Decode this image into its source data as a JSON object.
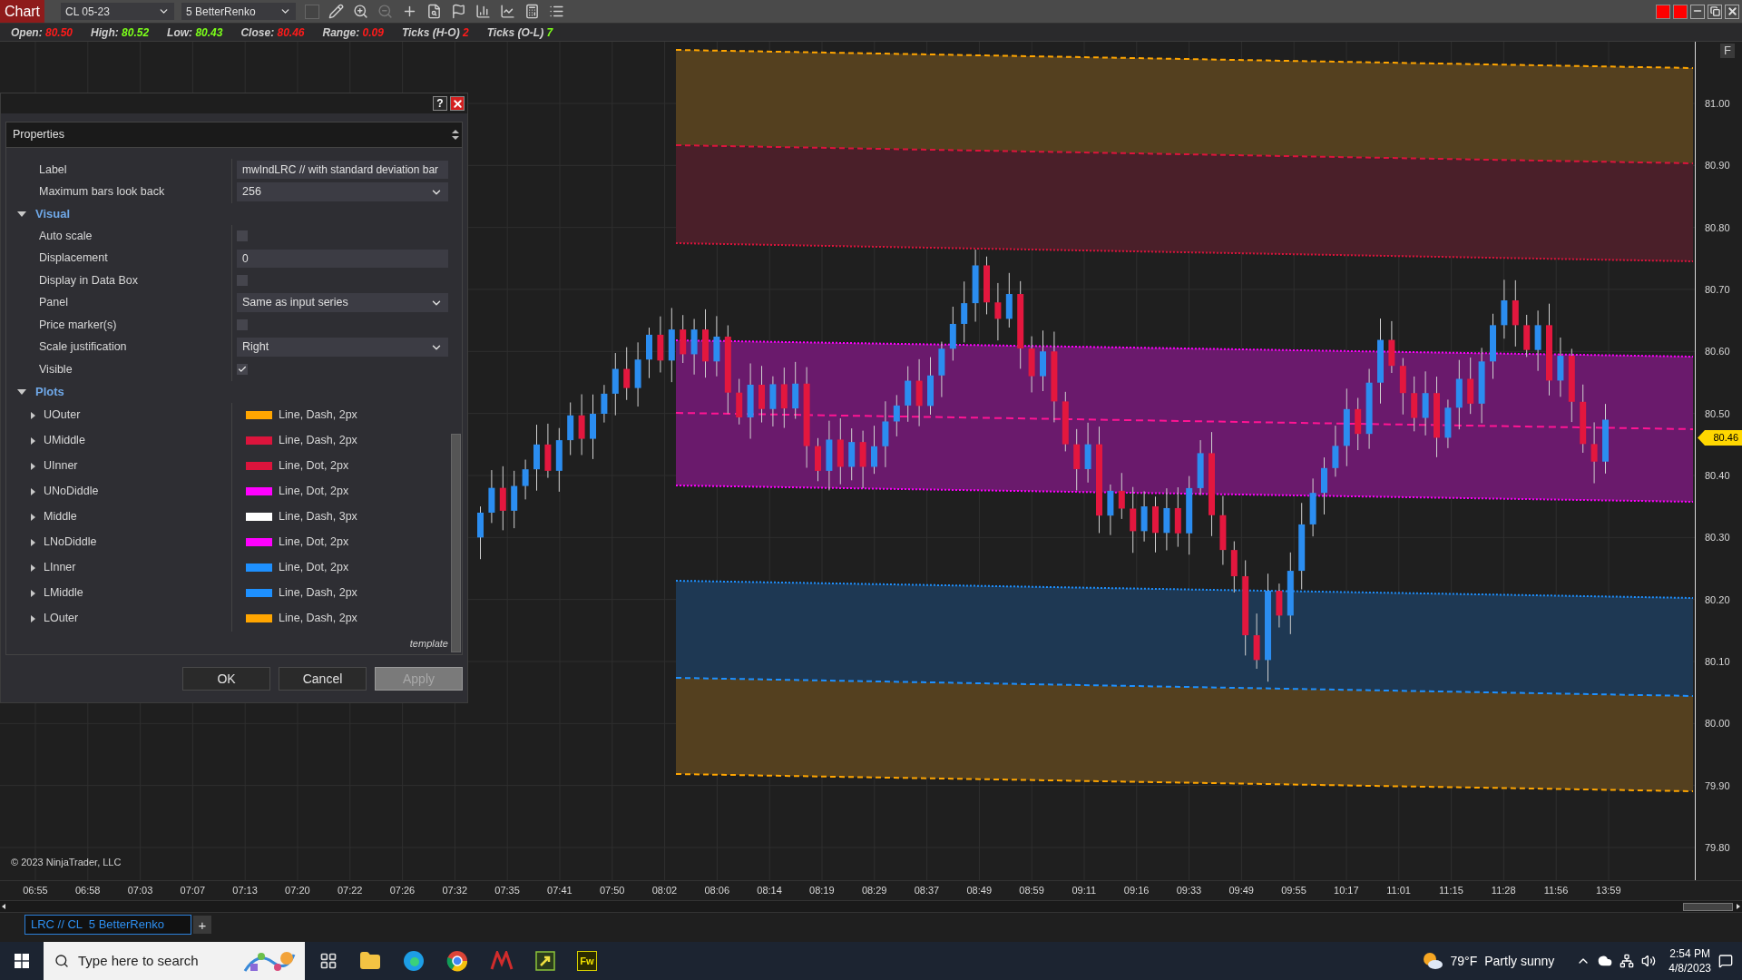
{
  "toolbar": {
    "title": "Chart",
    "instrument": "CL 05-23",
    "bar_type": "5 BetterRenko"
  },
  "data_line": [
    {
      "label": "Open:",
      "value": "80.50",
      "color": "#ff1a1a"
    },
    {
      "label": "High:",
      "value": "80.52",
      "color": "#7cff1a"
    },
    {
      "label": "Low:",
      "value": "80.43",
      "color": "#7cff1a"
    },
    {
      "label": "Close:",
      "value": "80.46",
      "color": "#ff1a1a"
    },
    {
      "label": "Range:",
      "value": "0.09",
      "color": "#ff1a1a"
    },
    {
      "label": "Ticks (H-O)",
      "value": "2",
      "color": "#ff1a1a"
    },
    {
      "label": "Ticks (O-L)",
      "value": "7",
      "color": "#7cff1a"
    }
  ],
  "dialog": {
    "help": "?",
    "header": "Properties",
    "properties": [
      {
        "kind": "text",
        "label": "Label",
        "value": "mwIndLRC // with standard deviation bar"
      },
      {
        "kind": "dropdown",
        "label": "Maximum bars look back",
        "value": "256"
      },
      {
        "kind": "section",
        "label": "Visual",
        "expanded": true
      },
      {
        "kind": "checkbox",
        "label": "Auto scale",
        "checked": false
      },
      {
        "kind": "text",
        "label": "Displacement",
        "value": "0"
      },
      {
        "kind": "checkbox",
        "label": "Display in Data Box",
        "checked": false
      },
      {
        "kind": "dropdown",
        "label": "Panel",
        "value": "Same as input series"
      },
      {
        "kind": "checkbox",
        "label": "Price marker(s)",
        "checked": false
      },
      {
        "kind": "dropdown",
        "label": "Scale justification",
        "value": "Right"
      },
      {
        "kind": "checkbox",
        "label": "Visible",
        "checked": true
      },
      {
        "kind": "section",
        "label": "Plots",
        "expanded": true
      }
    ],
    "plots": [
      {
        "name": "UOuter",
        "color": "#ffa500",
        "style": "Line, Dash, 2px",
        "expanded": false
      },
      {
        "name": "UMiddle",
        "color": "#dc143c",
        "style": "Line, Dash, 2px",
        "expanded": false
      },
      {
        "name": "UInner",
        "color": "#dc143c",
        "style": "Line, Dot, 2px",
        "expanded": false
      },
      {
        "name": "UNoDiddle",
        "color": "#ff00ff",
        "style": "Line, Dot, 2px",
        "expanded": false
      },
      {
        "name": "Middle",
        "color": "#ffffff",
        "style": "Line, Dash, 3px",
        "expanded": false
      },
      {
        "name": "LNoDiddle",
        "color": "#ff00ff",
        "style": "Line, Dot, 2px",
        "expanded": false
      },
      {
        "name": "LInner",
        "color": "#1e90ff",
        "style": "Line, Dot, 2px",
        "expanded": false
      },
      {
        "name": "LMiddle",
        "color": "#1e90ff",
        "style": "Line, Dash, 2px",
        "expanded": false
      },
      {
        "name": "LOuter",
        "color": "#ffa500",
        "style": "Line, Dash, 2px",
        "expanded": false
      }
    ],
    "template_link": "template",
    "buttons": [
      {
        "label": "OK",
        "disabled": false
      },
      {
        "label": "Cancel",
        "disabled": false
      },
      {
        "label": "Apply",
        "disabled": true
      }
    ]
  },
  "price_axis": {
    "scale_button": "F",
    "labels": [
      "81.00",
      "80.90",
      "80.80",
      "80.70",
      "80.60",
      "80.50",
      "80.40",
      "80.30",
      "80.20",
      "80.10",
      "80.00",
      "79.90",
      "79.80"
    ],
    "current_price": "80.46"
  },
  "copyright": "© 2023 NinjaTrader, LLC",
  "time_axis": {
    "labels": [
      "06:55",
      "06:58",
      "07:03",
      "07:07",
      "07:13",
      "07:20",
      "07:22",
      "07:26",
      "07:32",
      "07:35",
      "07:41",
      "07:50",
      "08:02",
      "08:06",
      "08:14",
      "08:19",
      "08:29",
      "08:37",
      "08:49",
      "08:59",
      "09:11",
      "09:16",
      "09:33",
      "09:49",
      "09:55",
      "10:17",
      "11:01",
      "11:15",
      "11:28",
      "11:56",
      "13:59"
    ]
  },
  "tabs": [
    {
      "label": "LRC // CL  5 BetterRenko",
      "selected": true
    }
  ],
  "add_tab": "+",
  "taskbar": {
    "search_placeholder": "Type here to search",
    "app_label": "Fw",
    "temperature": "79°F",
    "weather": "Partly sunny",
    "time": "2:54 PM",
    "date": "4/8/2023"
  }
}
